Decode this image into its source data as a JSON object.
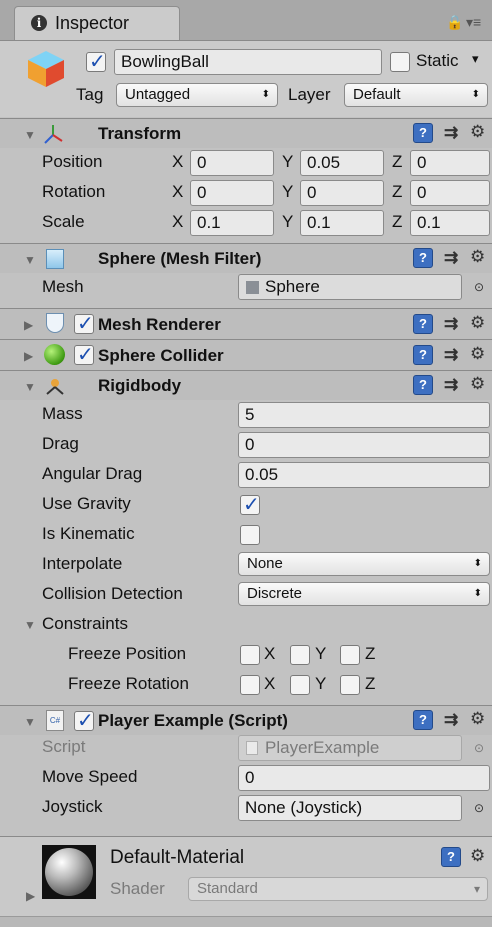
{
  "tab": {
    "title": "Inspector",
    "info_glyph": "i",
    "lock_glyph": "🔒",
    "menu_glyph": "▾≡"
  },
  "gameobject": {
    "name": "BowlingBall",
    "active": true,
    "static_label": "Static",
    "static_checked": false,
    "tag_label": "Tag",
    "tag_value": "Untagged",
    "layer_label": "Layer",
    "layer_value": "Default"
  },
  "glyphs": {
    "fold_open": "▼",
    "fold_closed": "▶",
    "help": "?",
    "preset": "⇉",
    "gear": "⚙",
    "target": "⊙",
    "popup_arrows": "⬍",
    "dropdown": "▾"
  },
  "transform": {
    "title": "Transform",
    "rows": [
      {
        "label": "Position",
        "x": "0",
        "y": "0.05",
        "z": "0"
      },
      {
        "label": "Rotation",
        "x": "0",
        "y": "0",
        "z": "0"
      },
      {
        "label": "Scale",
        "x": "0.1",
        "y": "0.1",
        "z": "0.1"
      }
    ],
    "axes": [
      "X",
      "Y",
      "Z"
    ]
  },
  "mesh_filter": {
    "title": "Sphere (Mesh Filter)",
    "mesh_label": "Mesh",
    "mesh_value": "Sphere"
  },
  "mesh_renderer": {
    "title": "Mesh Renderer",
    "enabled": true
  },
  "sphere_collider": {
    "title": "Sphere Collider",
    "enabled": true
  },
  "rigidbody": {
    "title": "Rigidbody",
    "mass_label": "Mass",
    "mass": "5",
    "drag_label": "Drag",
    "drag": "0",
    "angular_drag_label": "Angular Drag",
    "angular_drag": "0.05",
    "use_gravity_label": "Use Gravity",
    "use_gravity": true,
    "is_kinematic_label": "Is Kinematic",
    "is_kinematic": false,
    "interpolate_label": "Interpolate",
    "interpolate": "None",
    "collision_label": "Collision Detection",
    "collision": "Discrete",
    "constraints_label": "Constraints",
    "freeze_position_label": "Freeze Position",
    "freeze_rotation_label": "Freeze Rotation"
  },
  "player_script": {
    "title": "Player Example (Script)",
    "enabled": true,
    "icon_text": "C#",
    "script_label": "Script",
    "script_value": "PlayerExample",
    "move_speed_label": "Move Speed",
    "move_speed": "0",
    "joystick_label": "Joystick",
    "joystick_value": "None (Joystick)"
  },
  "material": {
    "name": "Default-Material",
    "shader_label": "Shader",
    "shader_value": "Standard"
  }
}
